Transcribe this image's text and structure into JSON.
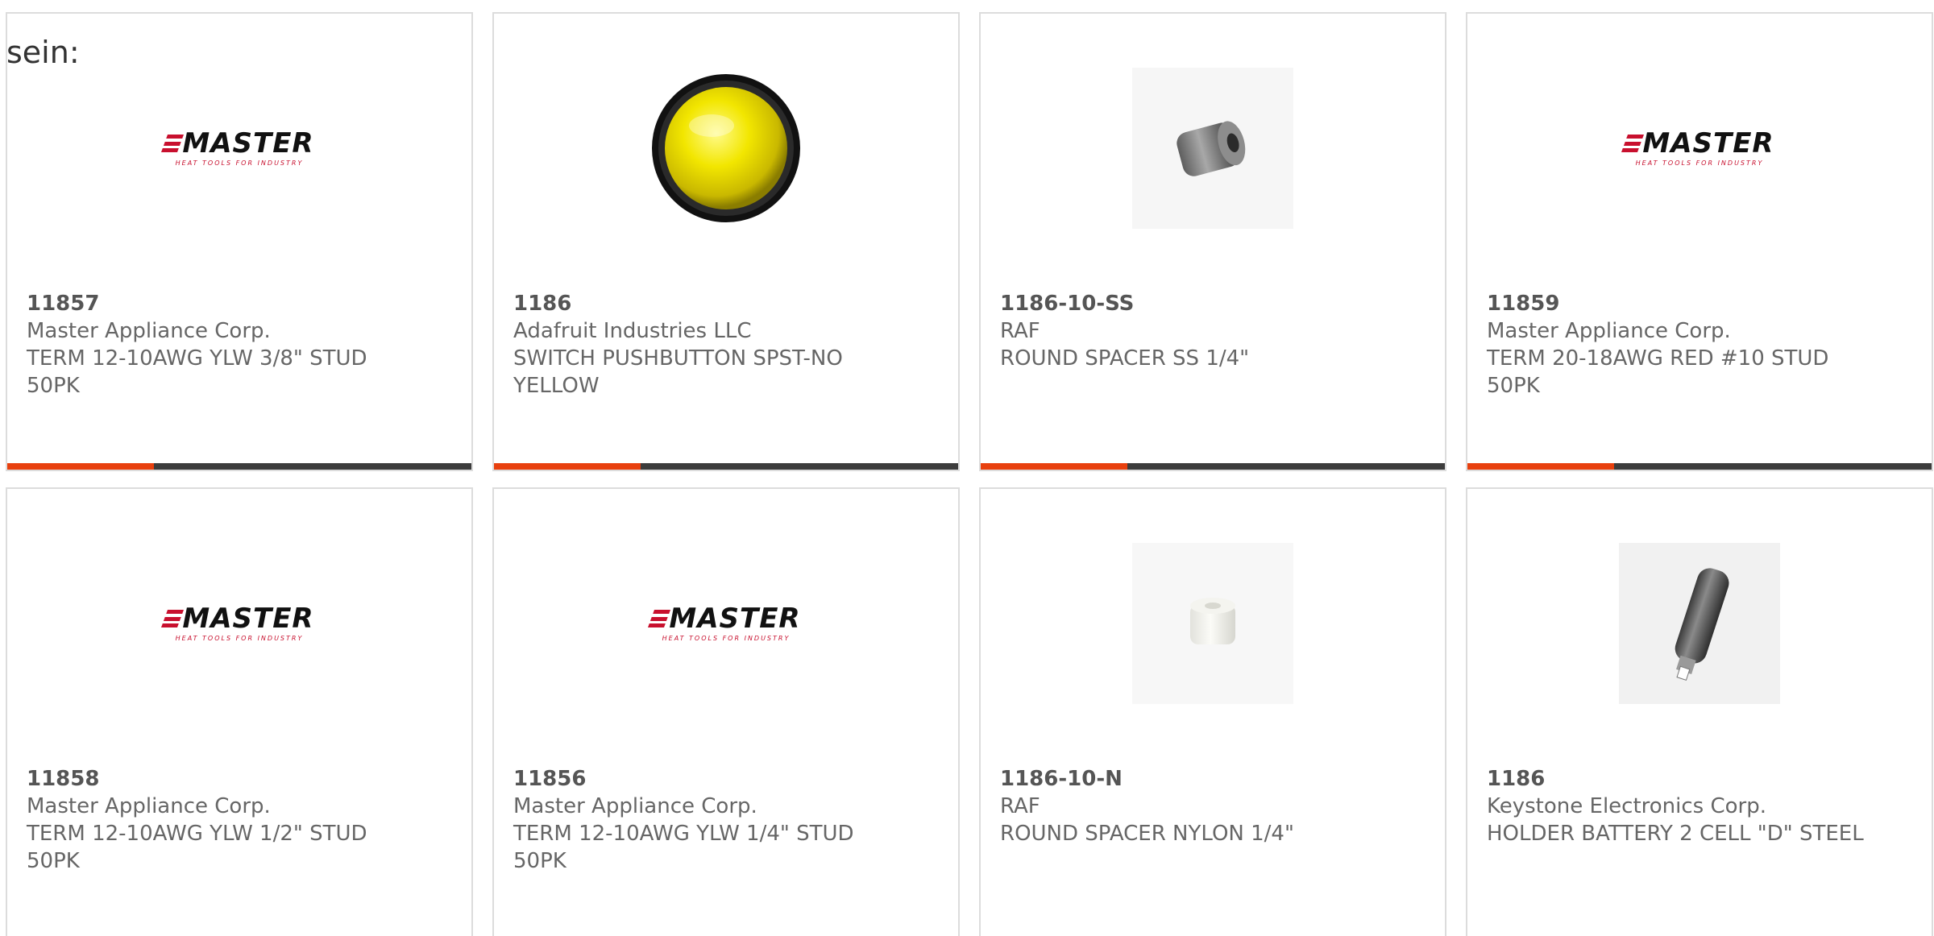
{
  "intro_text": "sein:",
  "logo": {
    "brand": "MASTER",
    "tagline": "HEAT TOOLS FOR INDUSTRY"
  },
  "colors": {
    "accent_bar": "#e8400e",
    "dark_bar": "#3c3c3c",
    "card_border": "#dcdcdc",
    "text": "#666666",
    "logo_red": "#c8102e"
  },
  "products": [
    {
      "part_number": "11857",
      "manufacturer": "Master Appliance Corp.",
      "description": "TERM 12-10AWG YLW 3/8\" STUD 50PK",
      "image": "master-logo"
    },
    {
      "part_number": "1186",
      "manufacturer": "Adafruit Industries LLC",
      "description": "SWITCH PUSHBUTTON SPST-NO YELLOW",
      "image": "yellow-pushbutton"
    },
    {
      "part_number": "1186-10-SS",
      "manufacturer": "RAF",
      "description": "ROUND SPACER SS 1/4\"",
      "image": "steel-spacer"
    },
    {
      "part_number": "11859",
      "manufacturer": "Master Appliance Corp.",
      "description": "TERM 20-18AWG RED #10 STUD 50PK",
      "image": "master-logo"
    },
    {
      "part_number": "11858",
      "manufacturer": "Master Appliance Corp.",
      "description": "TERM 12-10AWG YLW 1/2\" STUD 50PK",
      "image": "master-logo"
    },
    {
      "part_number": "11856",
      "manufacturer": "Master Appliance Corp.",
      "description": "TERM 12-10AWG YLW 1/4\" STUD 50PK",
      "image": "master-logo"
    },
    {
      "part_number": "1186-10-N",
      "manufacturer": "RAF",
      "description": "ROUND SPACER NYLON 1/4\"",
      "image": "nylon-spacer"
    },
    {
      "part_number": "1186",
      "manufacturer": "Keystone Electronics Corp.",
      "description": "HOLDER BATTERY 2 CELL \"D\" STEEL",
      "image": "battery-holder"
    }
  ]
}
